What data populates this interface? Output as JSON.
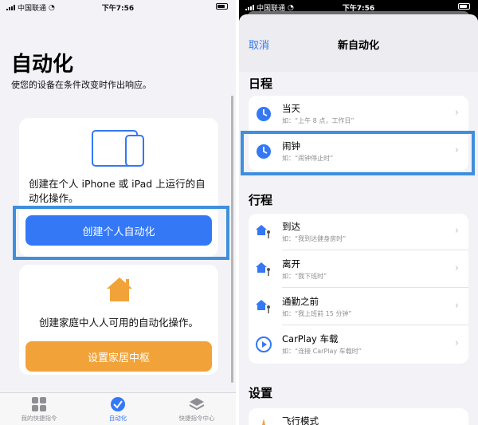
{
  "status": {
    "carrier": "中国联通",
    "time": "下午7:56"
  },
  "left": {
    "title": "自动化",
    "subtitle": "使您的设备在条件改变时作出响应。",
    "card_personal": {
      "text": "创建在个人 iPhone 或 iPad 上运行的自动化操作。",
      "button": "创建个人自动化"
    },
    "card_home": {
      "text": "创建家庭中人人可用的自动化操作。",
      "button": "设置家居中枢"
    },
    "tabs": [
      {
        "label": "我的快捷指令"
      },
      {
        "label": "自动化"
      },
      {
        "label": "快捷指令中心"
      }
    ]
  },
  "right": {
    "cancel": "取消",
    "title": "新自动化",
    "sections": [
      {
        "title": "日程",
        "rows": [
          {
            "title": "当天",
            "sub": "如：“上午 8 点，工作日”"
          },
          {
            "title": "闹钟",
            "sub": "如：“闹钟停止时”"
          }
        ]
      },
      {
        "title": "行程",
        "rows": [
          {
            "title": "到达",
            "sub": "如：“我到达健身房时”"
          },
          {
            "title": "离开",
            "sub": "如：“我下班时”"
          },
          {
            "title": "通勤之前",
            "sub": "如：“我上班前 15 分钟”"
          },
          {
            "title": "CarPlay 车载",
            "sub": "如：“连接 CarPlay 车载时”"
          }
        ]
      },
      {
        "title": "设置",
        "rows": [
          {
            "title": "飞行模式",
            "sub": ""
          }
        ]
      }
    ]
  },
  "colors": {
    "accent": "#3478f6",
    "home_orange": "#f1a33a",
    "highlight": "#3f8fdc"
  }
}
